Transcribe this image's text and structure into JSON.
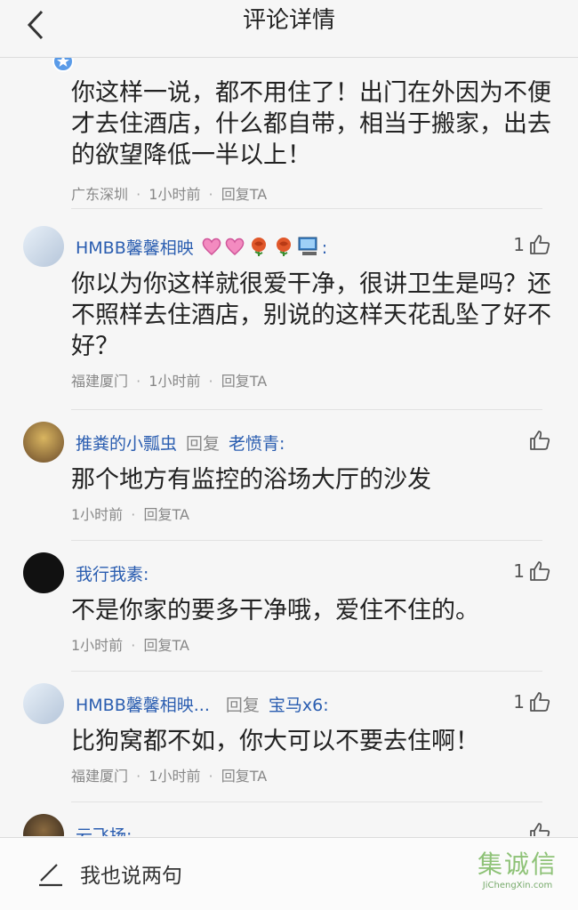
{
  "header": {
    "title": "评论详情"
  },
  "comments": [
    {
      "text": "你这样一说，都不用住了！出门在外因为不便才去住酒店，什么都自带，相当于搬家，出去的欲望降低一半以上！",
      "location": "广东深圳",
      "time": "1小时前",
      "reply": "回复TA"
    },
    {
      "name": "HMBB馨馨相映",
      "likes": "1",
      "text": "你以为你这样就很爱干净，很讲卫生是吗？还不照样去住酒店，别说的这样天花乱坠了好不好？",
      "location": "福建厦门",
      "time": "1小时前",
      "reply": "回复TA"
    },
    {
      "name": "推粪的小瓢虫",
      "reply_word": "回复",
      "reply_target": "老愤青:",
      "text": "那个地方有监控的浴场大厅的沙发",
      "time": "1小时前",
      "reply": "回复TA"
    },
    {
      "name": "我行我素:",
      "likes": "1",
      "text": "不是你家的要多干净哦，爱住不住的。",
      "time": "1小时前",
      "reply": "回复TA"
    },
    {
      "name": "HMBB馨馨相映...",
      "reply_word": "回复",
      "reply_target": "宝马x6:",
      "likes": "1",
      "text": "比狗窝都不如，你大可以不要去住啊！",
      "location": "福建厦门",
      "time": "1小时前",
      "reply": "回复TA"
    },
    {
      "name": "云飞扬:"
    }
  ],
  "footer": {
    "placeholder": "我也说两句"
  },
  "watermark": {
    "logo": "集诚信",
    "url": "JiChengXin.com"
  },
  "colors": {
    "name_blue": "#2a5db0",
    "meta_gray": "#888888",
    "background": "#f6f6f6"
  }
}
